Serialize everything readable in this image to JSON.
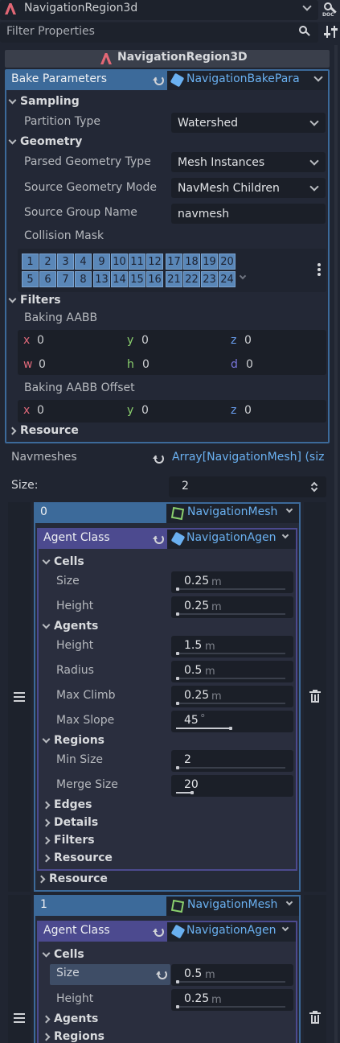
{
  "header": {
    "node_name": "NavigationRegion3d",
    "filter_placeholder": "Filter Properties"
  },
  "inspector": {
    "class_title": "NavigationRegion3D"
  },
  "bake": {
    "label": "Bake Parameters",
    "resource": "NavigationBakePara",
    "sampling": "Sampling",
    "partition_label": "Partition Type",
    "partition_value": "Watershed",
    "geometry": "Geometry",
    "parsed_label": "Parsed Geometry Type",
    "parsed_value": "Mesh Instances",
    "source_mode_label": "Source Geometry Mode",
    "source_mode_value": "NavMesh Children",
    "group_label": "Source Group Name",
    "group_value": "navmesh",
    "mask_label": "Collision Mask",
    "mask_row1": [
      "1",
      "2",
      "3",
      "4",
      "9",
      "10",
      "11",
      "12",
      "17",
      "18",
      "19",
      "20"
    ],
    "mask_row2": [
      "5",
      "6",
      "7",
      "8",
      "13",
      "14",
      "15",
      "16",
      "21",
      "22",
      "23",
      "24"
    ],
    "filters": "Filters",
    "aabb_label": "Baking AABB",
    "aabb": {
      "x": "0",
      "y": "0",
      "z": "0",
      "w": "0",
      "h": "0",
      "d": "0"
    },
    "aabb_offset_label": "Baking AABB Offset",
    "offset": {
      "x": "0",
      "y": "0",
      "z": "0"
    },
    "resource_section": "Resource"
  },
  "axes": {
    "x": "x",
    "y": "y",
    "z": "z",
    "w": "w",
    "h": "h",
    "d": "d"
  },
  "navmeshes": {
    "label": "Navmeshes",
    "value": "Array[NavigationMesh] (size",
    "size_label": "Size:",
    "size_value": "2"
  },
  "item0": {
    "index": "0",
    "type": "NavigationMesh",
    "agent_class": "Agent Class",
    "agent_res": "NavigationAgen",
    "cells": "Cells",
    "size_label": "Size",
    "size_value": "0.25",
    "height_label": "Height",
    "height_value": "0.25",
    "agents": "Agents",
    "a_height_label": "Height",
    "a_height_value": "1.5",
    "radius_label": "Radius",
    "radius_value": "0.5",
    "climb_label": "Max Climb",
    "climb_value": "0.25",
    "slope_label": "Max Slope",
    "slope_value": "45",
    "regions": "Regions",
    "min_label": "Min Size",
    "min_value": "2",
    "merge_label": "Merge Size",
    "merge_value": "20",
    "edges": "Edges",
    "details": "Details",
    "filters": "Filters",
    "resource_inner": "Resource",
    "resource_outer": "Resource"
  },
  "item1": {
    "index": "1",
    "type": "NavigationMesh",
    "agent_class": "Agent Class",
    "agent_res": "NavigationAgen",
    "cells": "Cells",
    "size_label": "Size",
    "size_value": "0.5",
    "height_label": "Height",
    "height_value": "0.25",
    "agents": "Agents",
    "regions": "Regions"
  },
  "units": {
    "m": "m",
    "deg": "°"
  },
  "colors": {
    "accent": "#5a87b8",
    "bake_header": "#3c6a9a",
    "agent_header": "#4c4a8f"
  }
}
